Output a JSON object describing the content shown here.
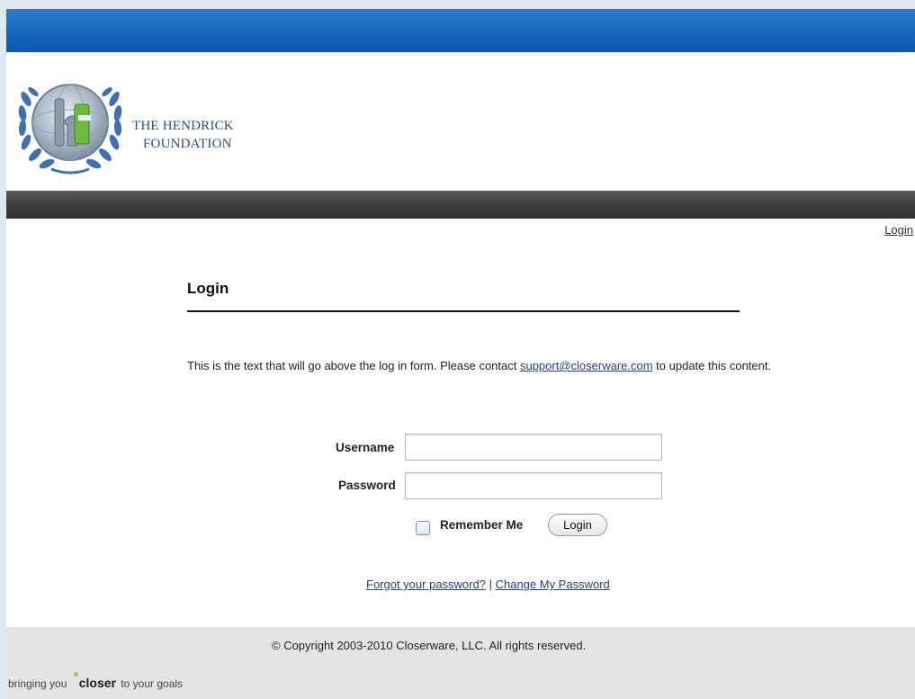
{
  "header": {
    "org_name_line1": "THE HENDRICK",
    "org_name_line2": "FOUNDATION",
    "logo_icon": "hf-laurel-logo-icon"
  },
  "nav": {
    "login_link": "Login"
  },
  "login": {
    "title": "Login",
    "intro_text_before": "This is the text that will go above the log in form. Please contact ",
    "support_email": "support@closerware.com",
    "intro_text_after": " to update this content.",
    "username_label": "Username",
    "username_value": "",
    "password_label": "Password",
    "password_value": "",
    "remember_label": "Remember Me",
    "login_button": "Login",
    "forgot_link": "Forgot your password?",
    "separator": "|",
    "change_link": "Change My Password"
  },
  "footer": {
    "copyright": "© Copyright 2003-2010 Closerware, LLC. All rights reserved.",
    "tagline_before": "bringing you",
    "tagline_brand": "closer",
    "tagline_after": "to your goals"
  },
  "colors": {
    "top_bar": "#1466bd",
    "nav_bar": "#404040",
    "link": "#1f3f8f",
    "org_name": "#2f4f7f",
    "footer_bg": "#e4e4e4"
  }
}
